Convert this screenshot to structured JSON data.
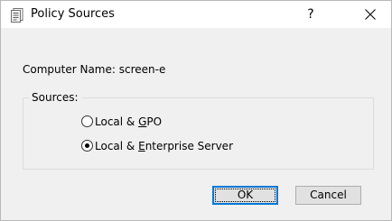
{
  "window": {
    "title": "Policy Sources",
    "help_label": "?",
    "close_label": "X"
  },
  "computer_name": {
    "text": "Computer Name: screen-e"
  },
  "sources": {
    "legend": "Sources:",
    "options": [
      {
        "label_prefix": "Local & ",
        "mnemonic": "G",
        "label_suffix": "PO",
        "selected": false
      },
      {
        "label_prefix": "Local & ",
        "mnemonic": "E",
        "label_suffix": "nterprise Server",
        "selected": true
      }
    ]
  },
  "buttons": {
    "ok_label": "OK",
    "cancel_label": "Cancel"
  },
  "icons": {
    "app": "policy-document-icon",
    "close": "close-icon"
  },
  "colors": {
    "dialog_bg": "#f0f0f0",
    "titlebar_bg": "#ffffff",
    "default_button_border": "#0078d7"
  }
}
